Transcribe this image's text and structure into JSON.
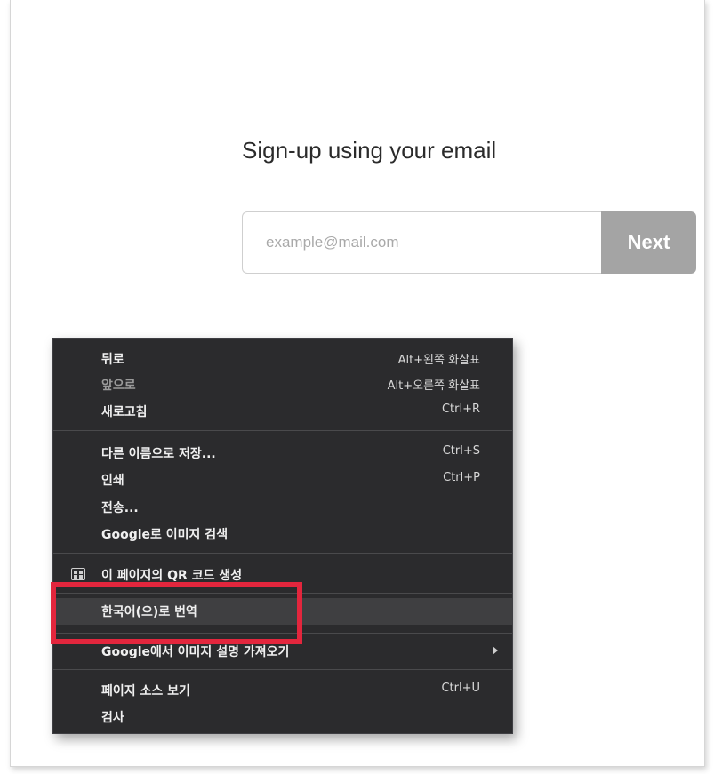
{
  "signup": {
    "title": "Sign-up using your email",
    "email_placeholder": "example@mail.com",
    "email_value": "",
    "next_label": "Next"
  },
  "context_menu": {
    "items": [
      {
        "label": "뒤로",
        "shortcut": "Alt+왼쪽 화살표",
        "enabled": true
      },
      {
        "label": "앞으로",
        "shortcut": "Alt+오른쪽 화살표",
        "enabled": false
      },
      {
        "label": "새로고침",
        "shortcut": "Ctrl+R",
        "enabled": true
      },
      {
        "label": "다른 이름으로 저장...",
        "shortcut": "Ctrl+S",
        "enabled": true
      },
      {
        "label": "인쇄",
        "shortcut": "Ctrl+P",
        "enabled": true
      },
      {
        "label": "전송...",
        "shortcut": "",
        "enabled": true
      },
      {
        "label": "Google로 이미지 검색",
        "shortcut": "",
        "enabled": true
      },
      {
        "label": "이 페이지의 QR 코드 생성",
        "shortcut": "",
        "enabled": true,
        "icon": "qr-code-icon"
      },
      {
        "label": "한국어(으)로 번역",
        "shortcut": "",
        "enabled": true,
        "highlighted": true
      },
      {
        "label": "Google에서 이미지 설명 가져오기",
        "shortcut": "",
        "enabled": true,
        "has_submenu": true
      },
      {
        "label": "페이지 소스 보기",
        "shortcut": "Ctrl+U",
        "enabled": true
      },
      {
        "label": "검사",
        "shortcut": "",
        "enabled": true
      }
    ]
  },
  "colors": {
    "highlight_box": "#e3263d",
    "next_button_bg": "#a4a4a4",
    "menu_bg": "#2b2b2d"
  }
}
